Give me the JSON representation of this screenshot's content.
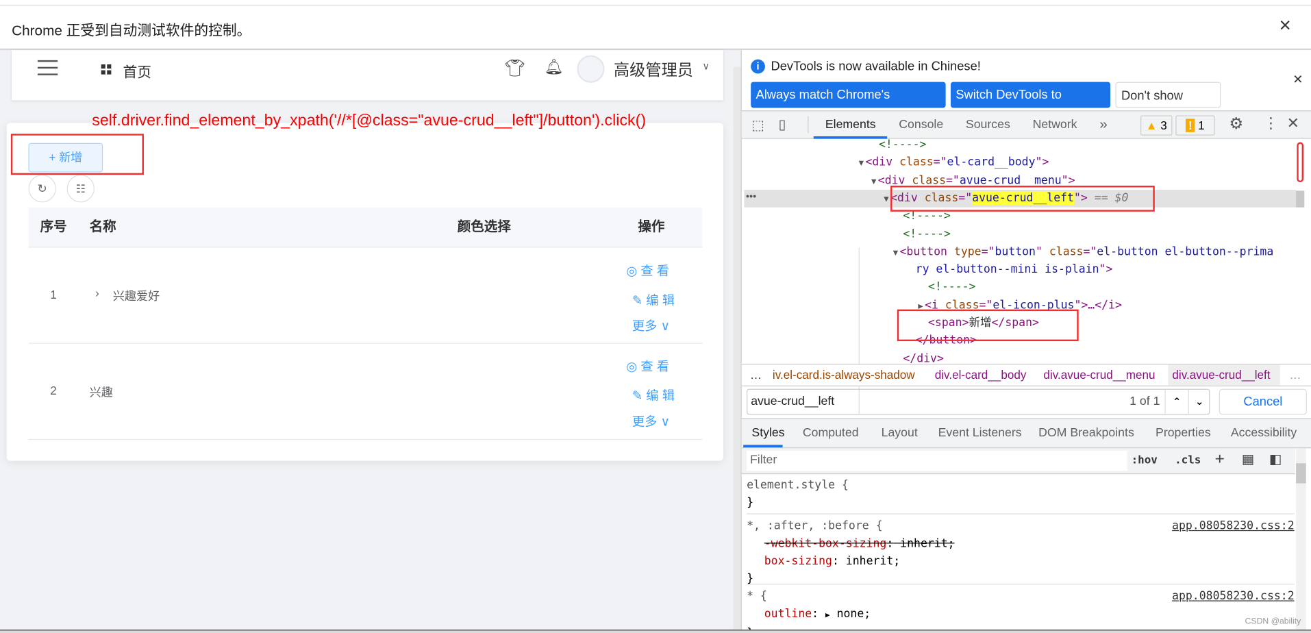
{
  "infobar": {
    "message": "Chrome 正受到自动测试软件的控制。",
    "close": "×"
  },
  "app": {
    "header": {
      "breadcrumb": "首页",
      "user": "高级管理员"
    },
    "annotation": "self.driver.find_element_by_xpath('//*[@class=\"avue-crud__left\"]/button').click()",
    "add_button": "+ 新增",
    "table": {
      "columns": [
        "序号",
        "名称",
        "颜色选择",
        "操作"
      ],
      "rows": [
        {
          "index": "1",
          "name": "兴趣爱好",
          "expandable": true
        },
        {
          "index": "2",
          "name": "兴趣",
          "expandable": false
        }
      ],
      "actions": {
        "view": "查 看",
        "edit": "编 辑",
        "more": "更多"
      }
    }
  },
  "devtools": {
    "banner": {
      "text": "DevTools is now available in Chinese!",
      "btn1": "Always match Chrome's language",
      "btn2": "Switch DevTools to Chinese",
      "btn3": "Don't show again"
    },
    "tabs": [
      "Elements",
      "Console",
      "Sources",
      "Network",
      "»"
    ],
    "warnings": "3",
    "errors": "1",
    "dom": [
      {
        "i": 0,
        "parts": [
          [
            "cm",
            "<!---->"
          ]
        ]
      },
      {
        "i": 1,
        "tri": "▼",
        "parts": [
          [
            "tg",
            "<div "
          ],
          [
            "an",
            "class"
          ],
          [
            "tg",
            "=\""
          ],
          [
            "av",
            "el-card__body"
          ],
          [
            "tg",
            "\">"
          ]
        ]
      },
      {
        "i": 2,
        "tri": "▼",
        "parts": [
          [
            "tg",
            "<div "
          ],
          [
            "an",
            "class"
          ],
          [
            "tg",
            "=\""
          ],
          [
            "av",
            "avue-crud__menu"
          ],
          [
            "tg",
            "\">"
          ]
        ]
      },
      {
        "i": 3,
        "tri": "▼",
        "sel": true,
        "parts": [
          [
            "tg",
            "<div "
          ],
          [
            "an",
            "class"
          ],
          [
            "tg",
            "=\""
          ],
          [
            "hl",
            "avue-crud__left"
          ],
          [
            "tg",
            "\">"
          ],
          [
            "dim",
            " == $0"
          ]
        ]
      },
      {
        "i": 4,
        "parts": [
          [
            "cm",
            "<!---->"
          ]
        ]
      },
      {
        "i": 4,
        "parts": [
          [
            "cm",
            "<!---->"
          ]
        ]
      },
      {
        "i": 4,
        "tri": "▼",
        "parts": [
          [
            "tg",
            "<button "
          ],
          [
            "an",
            "type"
          ],
          [
            "tg",
            "=\""
          ],
          [
            "av",
            "button"
          ],
          [
            "tg",
            "\" "
          ],
          [
            "an",
            "class"
          ],
          [
            "tg",
            "=\""
          ],
          [
            "av",
            "el-button el-button--prima"
          ]
        ]
      },
      {
        "i": 5,
        "parts": [
          [
            "av",
            "ry el-button--mini is-plain"
          ],
          [
            "tg",
            "\">"
          ]
        ]
      },
      {
        "i": 6,
        "parts": [
          [
            "cm",
            "<!---->"
          ]
        ]
      },
      {
        "i": 6,
        "tri": "▶",
        "parts": [
          [
            "tg",
            "<i "
          ],
          [
            "an",
            "class"
          ],
          [
            "tg",
            "=\""
          ],
          [
            "av",
            "el-icon-plus"
          ],
          [
            "tg",
            "\">…</i>"
          ]
        ]
      },
      {
        "i": 6,
        "parts": [
          [
            "tg",
            "<span>"
          ],
          [
            "tx",
            "新增"
          ],
          [
            "tg",
            "</span>"
          ]
        ]
      },
      {
        "i": 5,
        "parts": [
          [
            "tg",
            "</button>"
          ]
        ]
      },
      {
        "i": 4,
        "parts": [
          [
            "tg",
            "</div>"
          ]
        ]
      }
    ],
    "breadcrumbs": [
      "…",
      "iv.el-card.is-always-shadow",
      "div.el-card__body",
      "div.avue-crud__menu",
      "div.avue-crud__left",
      "…"
    ],
    "search": {
      "value": "avue-crud__left",
      "count": "1 of 1",
      "cancel": "Cancel"
    },
    "subtabs": [
      "Styles",
      "Computed",
      "Layout",
      "Event Listeners",
      "DOM Breakpoints",
      "Properties",
      "Accessibility"
    ],
    "filter": {
      "placeholder": "Filter",
      "hov": ":hov",
      "cls": ".cls"
    },
    "rules": {
      "r1": {
        "sel": "element.style {",
        "close": "}"
      },
      "r2": {
        "sel": "*, :after, :before {",
        "src": "app.08058230.css:2",
        "p1n": "-webkit-box-sizing",
        "p1v": " inherit;",
        "p2n": "box-sizing",
        "p2v": " inherit;",
        "close": "}"
      },
      "r3": {
        "sel": "* {",
        "src": "app.08058230.css:2",
        "p1n": "outline",
        "p1v": " none;",
        "close": "}"
      }
    },
    "watermark": "CSDN @ability"
  },
  "colors": {
    "primary": "#409eff",
    "annotation": "#ff0000",
    "devtools_blue": "#1a73e8"
  }
}
